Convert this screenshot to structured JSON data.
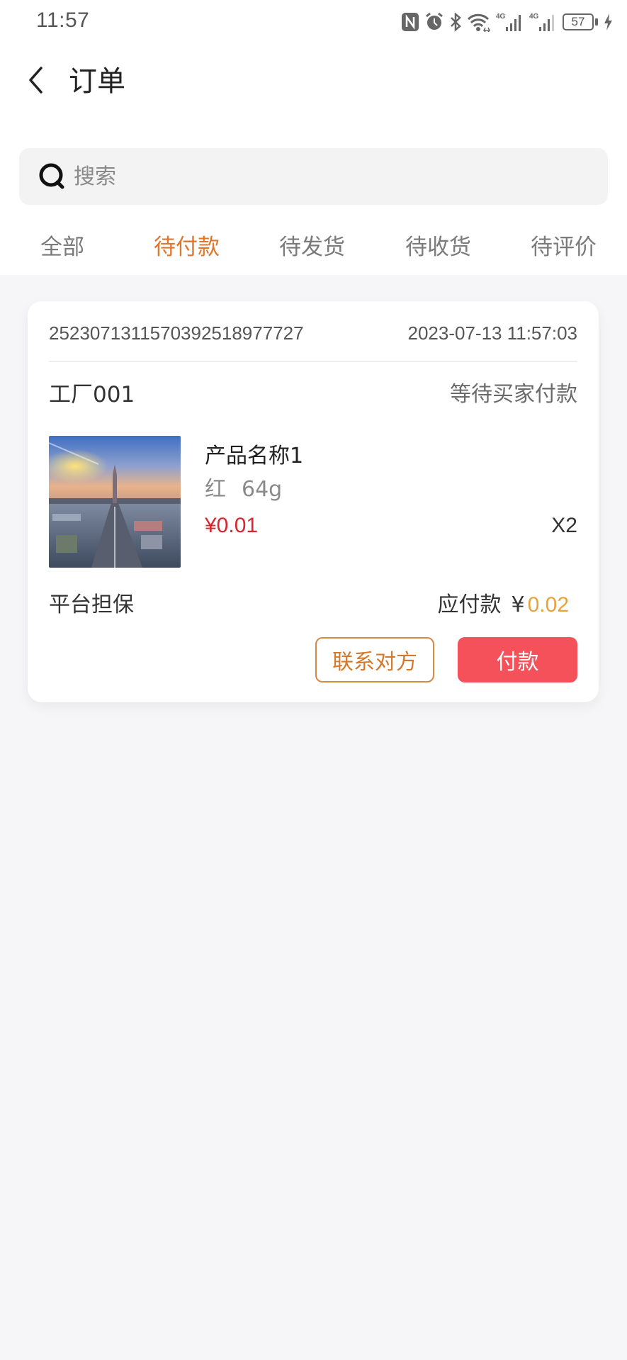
{
  "status_bar": {
    "time": "11:57",
    "icons": [
      "nfc-icon",
      "alarm-icon",
      "bluetooth-icon",
      "wifi-icon",
      "signal-4g-icon",
      "signal-4g-icon",
      "battery-icon",
      "charging-icon"
    ],
    "signal_label_1": "4G",
    "signal_label_2": "4G",
    "battery_level": "57"
  },
  "header": {
    "back_icon": "chevron-left-icon",
    "title": "订单"
  },
  "search": {
    "icon": "search-icon",
    "placeholder": "搜索",
    "value": ""
  },
  "tabs": [
    {
      "label": "全部",
      "active": false
    },
    {
      "label": "待付款",
      "active": true
    },
    {
      "label": "待发货",
      "active": false
    },
    {
      "label": "待收货",
      "active": false
    },
    {
      "label": "待评价",
      "active": false
    }
  ],
  "orders": [
    {
      "order_no": "25230713115703925189777 27",
      "order_no_display": "252307131157039251897772 7",
      "time": "2023-07-13 11:57:03",
      "shop": "工厂001",
      "status": "等待买家付款",
      "product": {
        "image": "city-bridge-sunset-photo",
        "name": "产品名称1",
        "color": "红",
        "weight": "64g",
        "price": "¥0.01",
        "quantity": "X2"
      },
      "guarantee": "平台担保",
      "total_label": "应付款",
      "total_currency": "¥",
      "total_amount": "0.02",
      "buttons": {
        "contact": "联系对方",
        "pay": "付款"
      }
    }
  ],
  "colors": {
    "accent_tab": "#e0752c",
    "price_red": "#d8262f",
    "total_amount": "#e8a23c",
    "pay_button": "#f5515a",
    "contact_border": "#d48a45",
    "page_background": "#f6f6f8"
  }
}
